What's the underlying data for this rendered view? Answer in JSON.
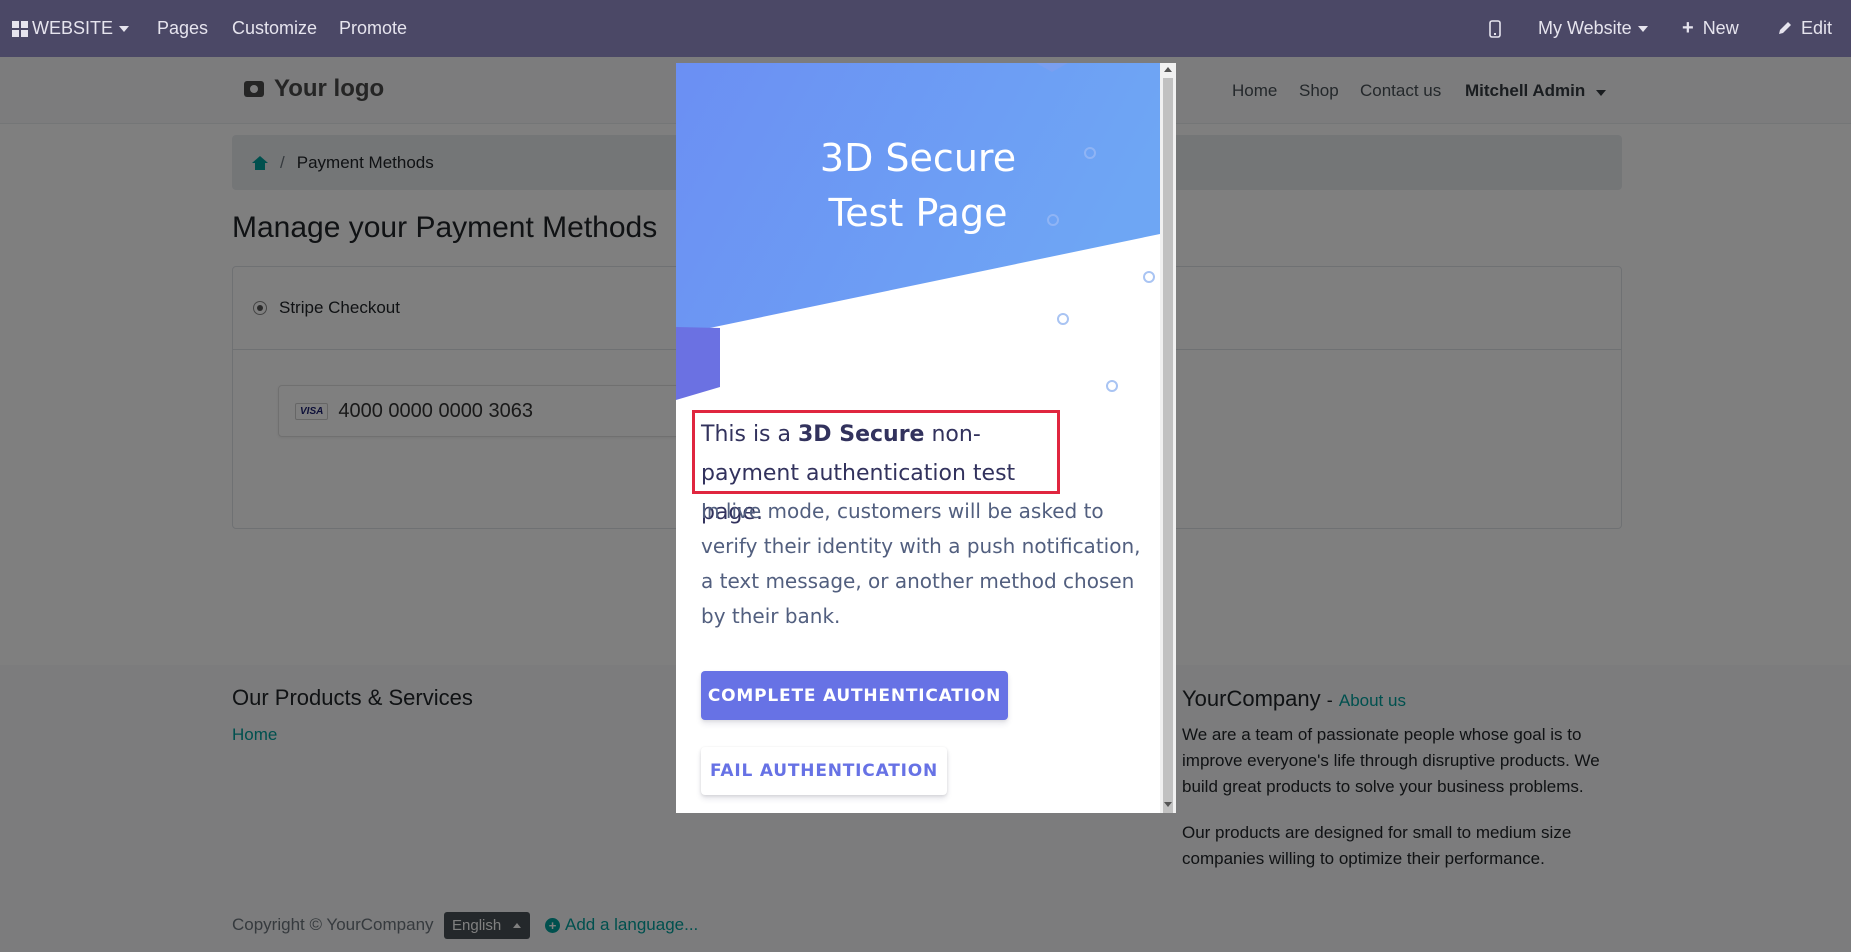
{
  "adminbar": {
    "app_label": "WEBSITE",
    "pages": "Pages",
    "customize": "Customize",
    "promote": "Promote",
    "site_selector": "My Website",
    "new_label": "New",
    "edit_label": "Edit",
    "icons": [
      "apps-grid-icon",
      "mobile-preview-icon",
      "plus-icon",
      "pencil-icon"
    ]
  },
  "header": {
    "logo_text": "Your logo",
    "nav": [
      "Home",
      "Shop",
      "Contact us"
    ],
    "user": "Mitchell Admin"
  },
  "breadcrumb": {
    "separator": "/",
    "current": "Payment Methods"
  },
  "main": {
    "title": "Manage your Payment Methods",
    "provider": "Stripe Checkout",
    "card_brand": "VISA",
    "card_number": "4000 0000 0000 3063"
  },
  "footer": {
    "products_title": "Our Products & Services",
    "products_link": "Home",
    "company_name": "YourCompany",
    "company_sep": "-",
    "about_link": "About us",
    "about_text_1": "We are a team of passionate people whose goal is to improve everyone's life through disruptive products. We build great products to solve your business problems.",
    "about_text_2": "Our products are designed for small to medium size companies willing to optimize their performance.",
    "social_icons": [
      "facebook-icon",
      "twitter-icon",
      "linkedin-icon",
      "youtube-icon",
      "google-plus-icon",
      "github-icon",
      "instagram-icon"
    ],
    "copyright": "Copyright © YourCompany",
    "language": "English",
    "add_language": "Add a language..."
  },
  "modal": {
    "title_line1": "3D Secure",
    "title_line2": "Test Page",
    "intro_prefix": "This is a",
    "intro_bold": "3D Secure",
    "intro_suffix": "non-payment authentication test page.",
    "body": "In live mode, customers will be asked to verify their identity with a push notification, a text message, or another method chosen by their bank.",
    "complete_button": "COMPLETE AUTHENTICATION",
    "fail_button": "FAIL AUTHENTICATION"
  },
  "colors": {
    "admin_bar": "#875a7b",
    "stripe_blurple": "#6772e5",
    "highlight": "#e0263f",
    "link": "#00A09D"
  }
}
